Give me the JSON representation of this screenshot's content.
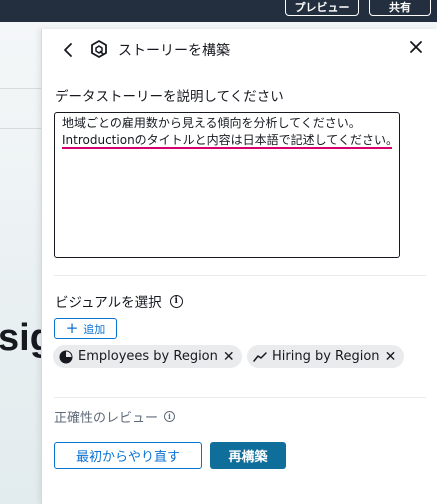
{
  "topbar": {
    "preview_label": "プレビュー",
    "share_label": "共有"
  },
  "background": {
    "partial_text": "sig"
  },
  "panel": {
    "title": "ストーリーを構築",
    "describe_label": "データストーリーを説明してください",
    "prompt_lines": [
      "地域ごとの雇用数から見える傾向を分析してください。",
      "Introductionのタイトルと内容は日本語で記述してください。"
    ],
    "visuals_label": "ビジュアルを選択",
    "add_label": "追加",
    "visuals": [
      {
        "label": "Employees by Region",
        "icon": "pie-chart-icon"
      },
      {
        "label": "Hiring by Region",
        "icon": "line-chart-icon"
      }
    ],
    "review_label": "正確性のレビュー",
    "restart_label": "最初からやり直す",
    "rebuild_label": "再構築"
  },
  "colors": {
    "accent": "#0972d3",
    "primary_button": "#0f6e9a",
    "spellcheck": "#d5006e",
    "topbar": "#232f3e"
  }
}
